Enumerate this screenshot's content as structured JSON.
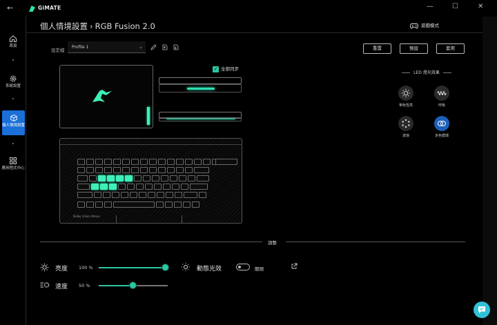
{
  "app": {
    "title": "GiMATE"
  },
  "window": {
    "back": "←",
    "minimize": "—",
    "maximize": "☐",
    "close": "✕"
  },
  "sidebar": {
    "items": [
      {
        "label": "首頁",
        "icon": "home-icon"
      },
      {
        "label": "系統設置",
        "icon": "gear-icon"
      },
      {
        "label": "個人情境設置",
        "icon": "cube-icon",
        "active": true
      },
      {
        "label": "應用程式中心",
        "icon": "apps-grid-icon"
      }
    ]
  },
  "header": {
    "breadcrumb_parent": "個人情境設置",
    "separator": "›",
    "breadcrumb_current": "RGB Fusion 2.0",
    "game_mode": "遊戲模式"
  },
  "profile": {
    "label": "設定檔",
    "value": "Profile 1"
  },
  "buttons": {
    "reset": "重置",
    "preview": "預設",
    "apply": "套用"
  },
  "sync": {
    "label": "全部同步",
    "checked": true
  },
  "keyboard": {
    "brand_text": "Dolby Vision Atmos"
  },
  "led": {
    "title": "LED 燈光效果",
    "effects": [
      {
        "label": "單色恆亮",
        "icon": "sun-icon"
      },
      {
        "label": "呼吸",
        "icon": "wave-icon"
      },
      {
        "label": "波浪",
        "icon": "dots-circle-icon"
      },
      {
        "label": "多色循環",
        "icon": "cycle-icon",
        "selected": true
      }
    ]
  },
  "adjust": {
    "title": "調整",
    "brightness": {
      "label": "亮度",
      "value_text": "100 %",
      "value": 1.0
    },
    "speed": {
      "label": "速度",
      "value_text": "50 %",
      "value": 0.5
    },
    "dynamic": {
      "label": "動態光效",
      "state": "關閉",
      "on": false
    }
  },
  "colors": {
    "accent": "#2bc7a0",
    "active_nav": "#1a6fd8",
    "chat": "#32c0d8"
  }
}
